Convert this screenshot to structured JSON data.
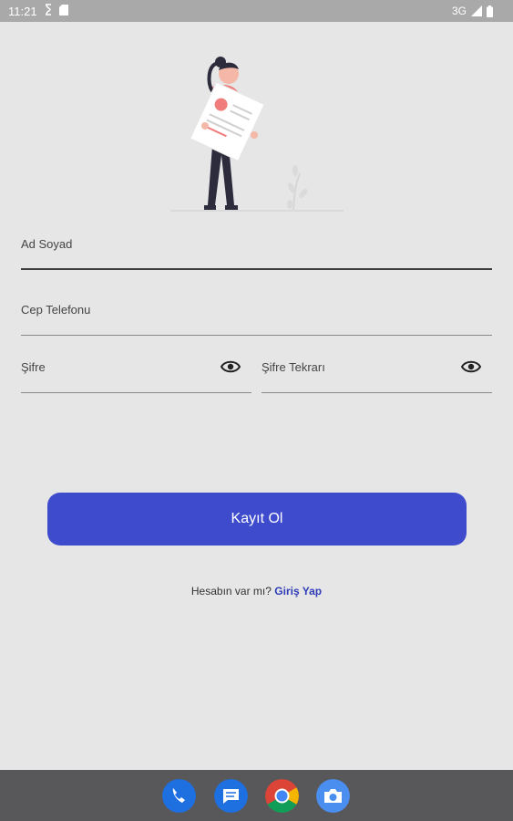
{
  "status_bar": {
    "time": "11:21",
    "network": "3G",
    "icons": [
      "sync-icon",
      "sd-card-icon",
      "signal-icon",
      "battery-icon"
    ]
  },
  "illustration": {
    "icon": "person-holding-document-illustration"
  },
  "form": {
    "name_label": "Ad Soyad",
    "phone_label": "Cep Telefonu",
    "password_label": "Şifre",
    "password_repeat_label": "Şifre Tekrarı",
    "password_toggle_icon": "eye-icon"
  },
  "register_button": {
    "label": "Kayıt Ol",
    "color": "#3e4bcd"
  },
  "login_prompt": {
    "text": "Hesabın var mı?",
    "link": "Giriş Yap",
    "link_color": "#2f3db8"
  },
  "dock": {
    "icons": [
      "phone-icon",
      "messages-icon",
      "chrome-icon",
      "camera-icon"
    ]
  }
}
